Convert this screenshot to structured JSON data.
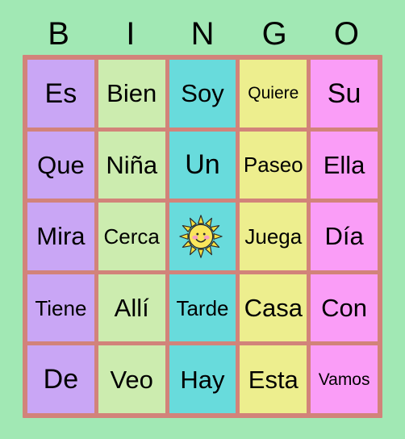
{
  "card": {
    "title": "BINGO",
    "background_color": "#a1e8b4",
    "grid_border_color": "#d2837a",
    "header": [
      {
        "letter": "B",
        "color": "#c9a6f5"
      },
      {
        "letter": "I",
        "color": "#ccecaf"
      },
      {
        "letter": "N",
        "color": "#68dbdc"
      },
      {
        "letter": "G",
        "color": "#edee8e"
      },
      {
        "letter": "O",
        "color": "#fa9df7"
      }
    ],
    "rows": [
      [
        {
          "text": "Es",
          "size": "xl"
        },
        {
          "text": "Bien",
          "size": "lg"
        },
        {
          "text": "Soy",
          "size": "lg"
        },
        {
          "text": "Quiere",
          "size": "sm"
        },
        {
          "text": "Su",
          "size": "xl"
        }
      ],
      [
        {
          "text": "Que",
          "size": "lg"
        },
        {
          "text": "Niña",
          "size": "lg"
        },
        {
          "text": "Un",
          "size": "xl"
        },
        {
          "text": "Paseo",
          "size": "md"
        },
        {
          "text": "Ella",
          "size": "lg"
        }
      ],
      [
        {
          "text": "Mira",
          "size": "lg"
        },
        {
          "text": "Cerca",
          "size": "md"
        },
        {
          "text": "",
          "size": "md",
          "icon": "sun-icon",
          "free_space": true
        },
        {
          "text": "Juega",
          "size": "md"
        },
        {
          "text": "Día",
          "size": "lg"
        }
      ],
      [
        {
          "text": "Tiene",
          "size": "md"
        },
        {
          "text": "Allí",
          "size": "lg"
        },
        {
          "text": "Tarde",
          "size": "md"
        },
        {
          "text": "Casa",
          "size": "lg"
        },
        {
          "text": "Con",
          "size": "lg"
        }
      ],
      [
        {
          "text": "De",
          "size": "xl"
        },
        {
          "text": "Veo",
          "size": "lg"
        },
        {
          "text": "Hay",
          "size": "lg"
        },
        {
          "text": "Esta",
          "size": "lg"
        },
        {
          "text": "Vamos",
          "size": "sm"
        }
      ]
    ],
    "free_space_icon": {
      "name": "sun-icon",
      "body_color": "#f9e65c",
      "outline_color": "#2b2b2b",
      "ray_color": "#f7e13f",
      "cheek_color": "#f79fc0",
      "face_color": "#2b2b2b"
    }
  }
}
